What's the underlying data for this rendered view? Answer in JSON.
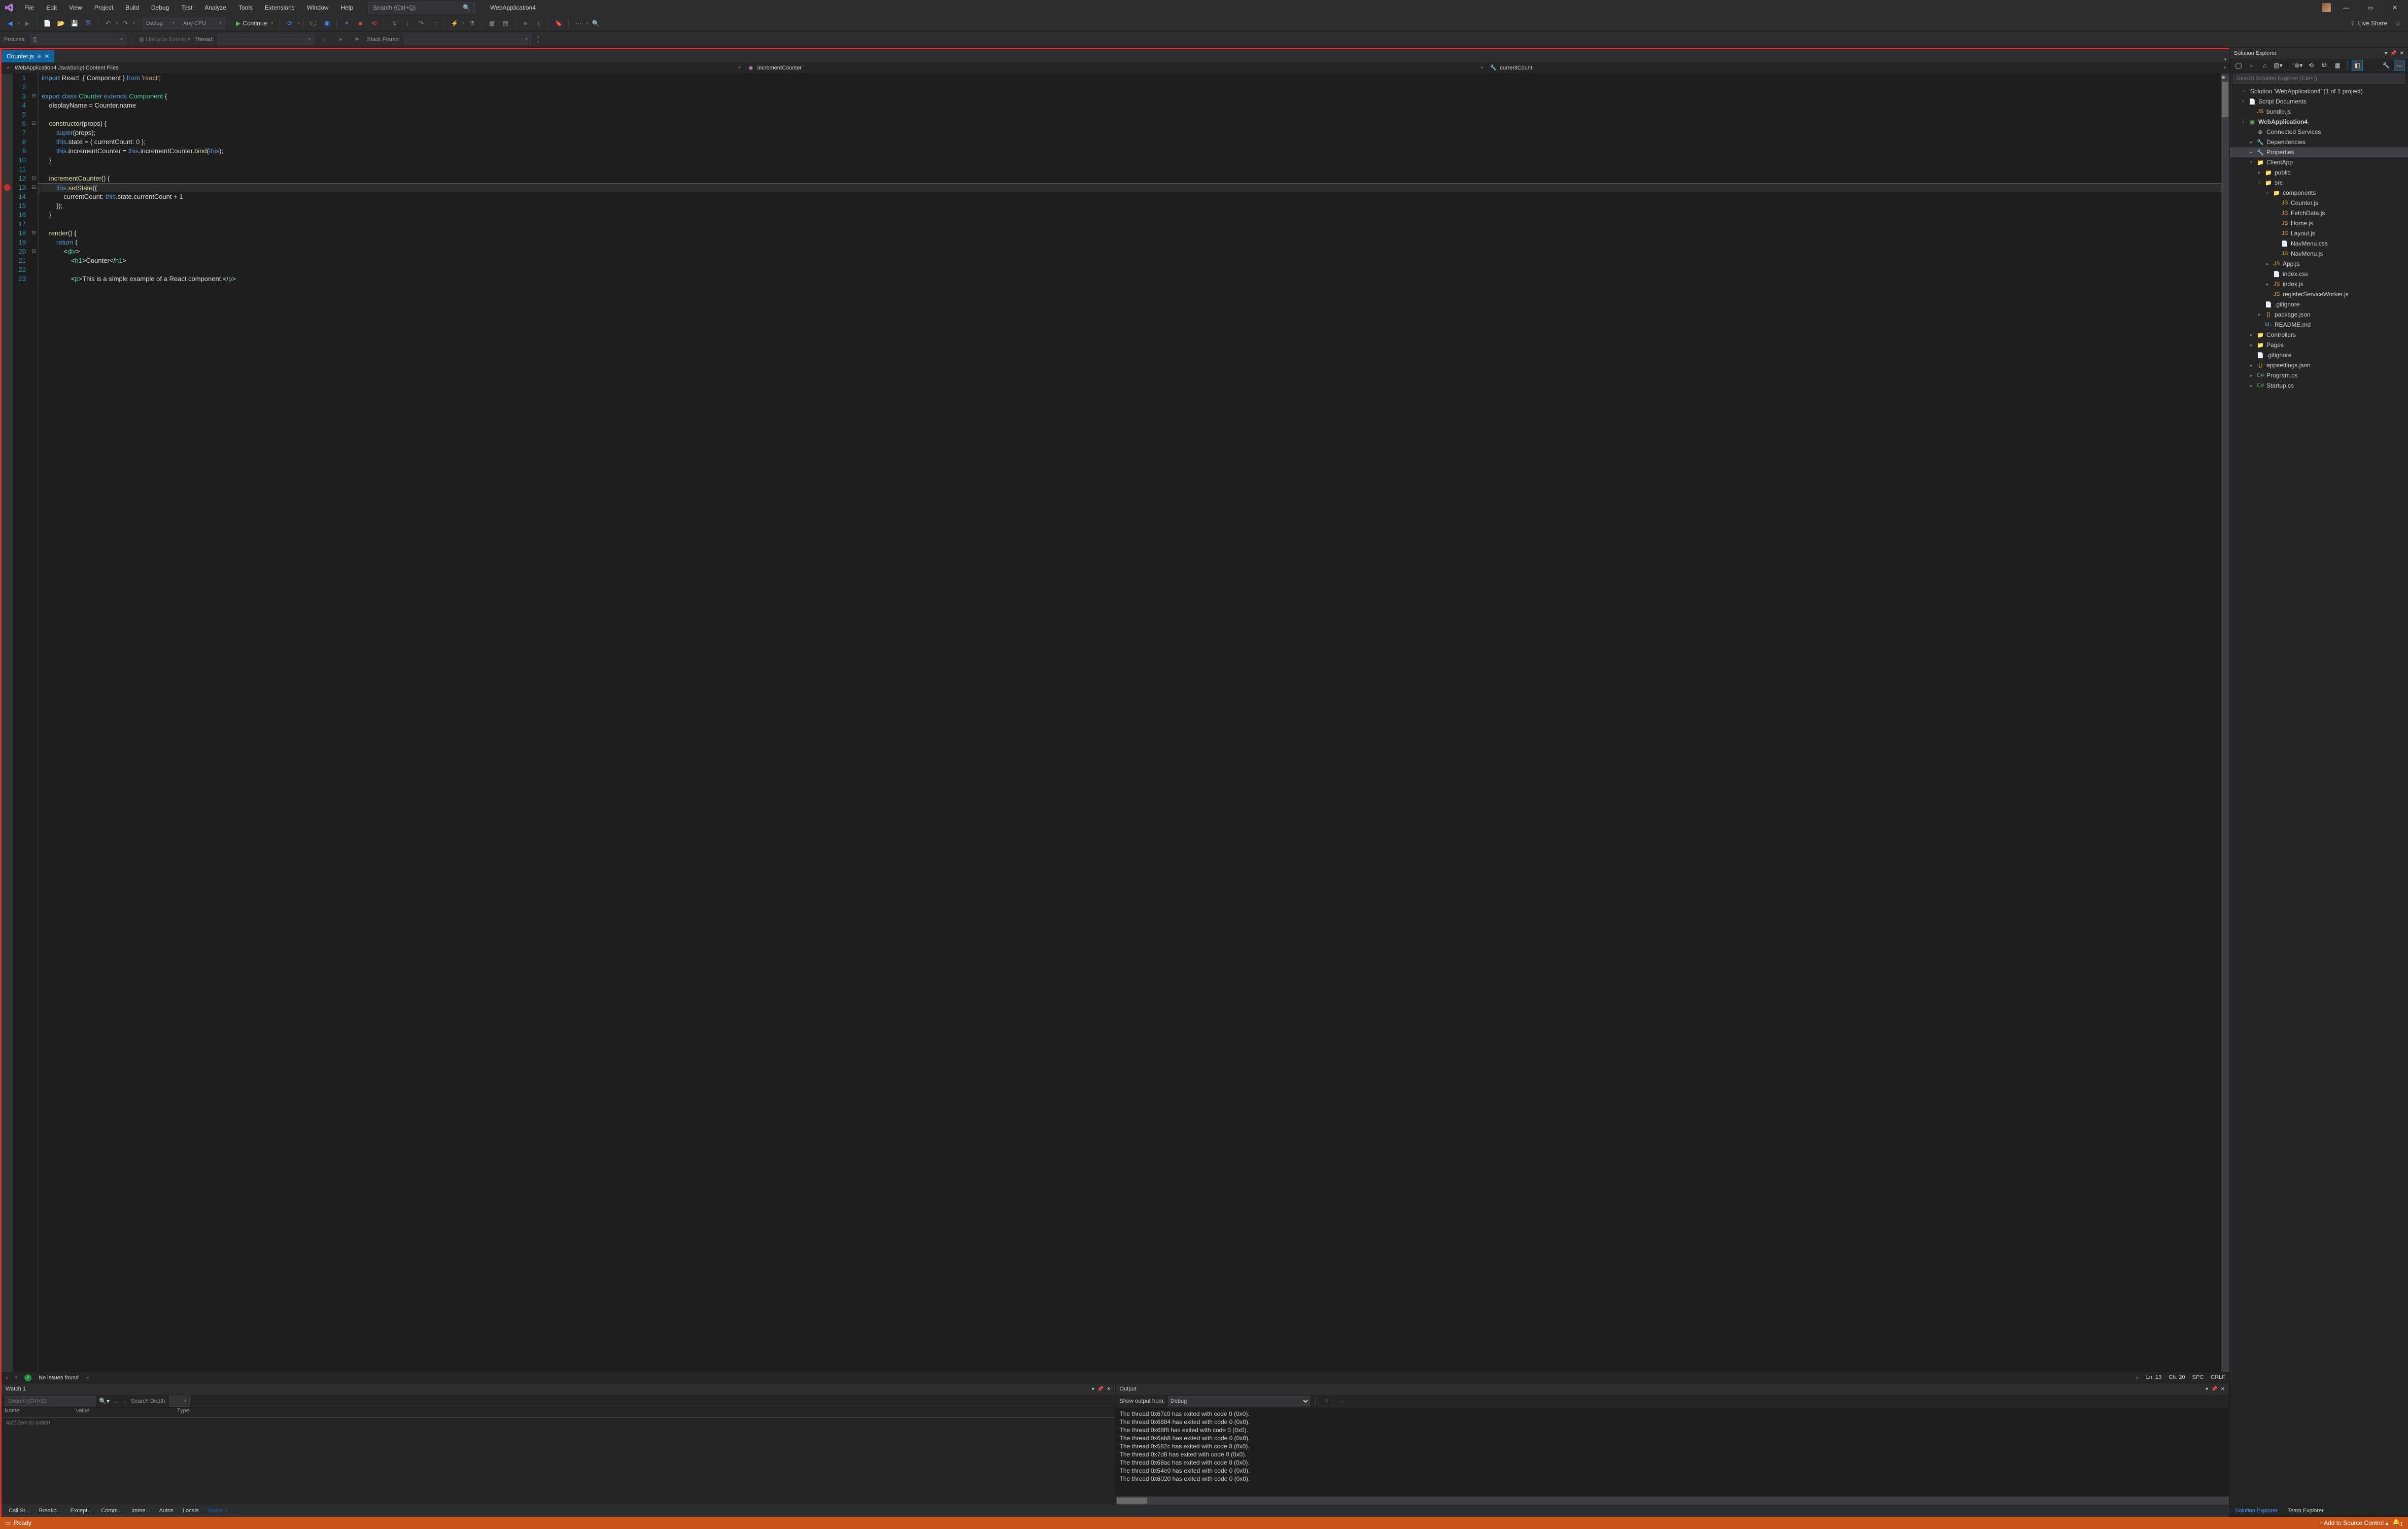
{
  "title": "WebApplication4",
  "searchPlaceholder": "Search (Ctrl+Q)",
  "menu": [
    "File",
    "Edit",
    "View",
    "Project",
    "Build",
    "Debug",
    "Test",
    "Analyze",
    "Tools",
    "Extensions",
    "Window",
    "Help"
  ],
  "toolbar": {
    "config": "Debug",
    "platform": "Any CPU",
    "continue": "Continue",
    "liveshare": "Live Share",
    "process": "Process:",
    "processVal": "[]",
    "lifecycle": "Lifecycle Events",
    "thread": "Thread:",
    "stackframe": "Stack Frame:"
  },
  "tab": {
    "name": "Counter.js"
  },
  "navbar": {
    "scope": "WebApplication4 JavaScript Content Files",
    "member": "incrementCounter",
    "detail": "currentCount"
  },
  "code": {
    "lines": [
      {
        "n": 1,
        "f": "",
        "h": "<span class='k-blue'>import</span> React, { Component } <span class='k-blue'>from</span> <span class='k-str'>'react'</span>;",
        "ind": 1
      },
      {
        "n": 2,
        "f": "",
        "h": "",
        "ind": 1
      },
      {
        "n": 3,
        "f": "⊟",
        "h": "<span class='k-blue'>export</span> <span class='k-blue'>class</span> <span class='k-type'>Counter</span> <span class='k-blue'>extends</span> <span class='k-type'>Component</span> {",
        "ind": 0
      },
      {
        "n": 4,
        "f": "",
        "h": "    displayName = Counter.name",
        "ind": 1
      },
      {
        "n": 5,
        "f": "",
        "h": "",
        "ind": 1
      },
      {
        "n": 6,
        "f": "⊟",
        "h": "    <span class='k-func'>constructor</span>(props) {",
        "ind": 1
      },
      {
        "n": 7,
        "f": "",
        "h": "        <span class='k-blue'>super</span>(props);",
        "ind": 1
      },
      {
        "n": 8,
        "f": "",
        "h": "        <span class='k-blue'>this</span>.state = { currentCount: <span class='k-num'>0</span> };",
        "ind": 1
      },
      {
        "n": 9,
        "f": "",
        "h": "        <span class='k-blue'>this</span>.incrementCounter = <span class='k-blue'>this</span>.incrementCounter.<span class='k-func'>bind</span>(<span class='k-blue'>this</span>);",
        "ind": 1
      },
      {
        "n": 10,
        "f": "",
        "h": "    }",
        "ind": 1
      },
      {
        "n": 11,
        "f": "",
        "h": "",
        "ind": 1
      },
      {
        "n": 12,
        "f": "⊟",
        "h": "    <span class='k-func'>incrementCounter</span>() {",
        "ind": 1
      },
      {
        "n": 13,
        "f": "⊟",
        "h": "        <span class='k-blue'>this</span>.<span class='k-func'>setState</span>({",
        "ind": 1,
        "bp": true,
        "cur": true
      },
      {
        "n": 14,
        "f": "",
        "h": "            currentCount: <span class='k-blue'>this</span>.state.currentCount + <span class='k-num'>1</span>",
        "ind": 1
      },
      {
        "n": 15,
        "f": "",
        "h": "        });",
        "ind": 1
      },
      {
        "n": 16,
        "f": "",
        "h": "    }",
        "ind": 1
      },
      {
        "n": 17,
        "f": "",
        "h": "",
        "ind": 1
      },
      {
        "n": 18,
        "f": "⊟",
        "h": "    <span class='k-func'>render</span>() {",
        "ind": 1
      },
      {
        "n": 19,
        "f": "",
        "h": "        <span class='k-blue'>return</span> (",
        "ind": 1
      },
      {
        "n": 20,
        "f": "⊟",
        "h": "            &lt;<span class='k-type'>div</span>&gt;",
        "ind": 1
      },
      {
        "n": 21,
        "f": "",
        "h": "                &lt;<span class='k-type'>h1</span>&gt;Counter&lt;/<span class='k-type'>h1</span>&gt;",
        "ind": 1
      },
      {
        "n": 22,
        "f": "",
        "h": "",
        "ind": 1
      },
      {
        "n": 23,
        "f": "",
        "h": "                &lt;<span class='k-type'>p</span>&gt;This is a simple example of a React component.&lt;/<span class='k-type'>p</span>&gt;",
        "ind": 1
      }
    ],
    "status": {
      "issues": "No issues found",
      "ln": "Ln: 13",
      "ch": "Ch: 20",
      "spc": "SPC",
      "crlf": "CRLF"
    }
  },
  "watch": {
    "title": "Watch 1",
    "searchPh": "Search (Ctrl+E)",
    "depth": "Search Depth:",
    "cols": [
      "Name",
      "Value",
      "Type"
    ],
    "placeholder": "Add item to watch"
  },
  "output": {
    "title": "Output",
    "fromLbl": "Show output from:",
    "from": "Debug",
    "lines": [
      "The thread 0x67c0 has exited with code 0 (0x0).",
      "The thread 0x6884 has exited with code 0 (0x0).",
      "The thread 0x68f8 has exited with code 0 (0x0).",
      "The thread 0x6ab8 has exited with code 0 (0x0).",
      "The thread 0x582c has exited with code 0 (0x0).",
      "The thread 0x7d8 has exited with code 0 (0x0).",
      "The thread 0x68ac has exited with code 0 (0x0).",
      "The thread 0x54e0 has exited with code 0 (0x0).",
      "The thread 0x6020 has exited with code 0 (0x0)."
    ]
  },
  "bottomTabs": [
    "Call St...",
    "Breakp...",
    "Except...",
    "Comm...",
    "Imme...",
    "Autos",
    "Locals",
    "Watch 1"
  ],
  "se": {
    "title": "Solution Explorer",
    "searchPh": "Search Solution Explorer (Ctrl+;)",
    "solution": "Solution 'WebApplication4' (1 of 1 project)",
    "tabs": [
      "Solution Explorer",
      "Team Explorer"
    ]
  },
  "tree": [
    {
      "d": 0,
      "e": "",
      "i": "i-sln",
      "t": "Solution 'WebApplication4' (1 of 1 project)"
    },
    {
      "d": 1,
      "e": "▿",
      "i": "i-scr",
      "t": "Script Documents"
    },
    {
      "d": 2,
      "e": "",
      "i": "i-js",
      "t": "bundle.js"
    },
    {
      "d": 1,
      "e": "▿",
      "i": "i-proj",
      "t": "WebApplication4",
      "b": true
    },
    {
      "d": 2,
      "e": "",
      "i": "i-conn",
      "t": "Connected Services"
    },
    {
      "d": 2,
      "e": "▸",
      "i": "i-wr",
      "t": "Dependencies"
    },
    {
      "d": 2,
      "e": "▸",
      "i": "i-wr",
      "t": "Properties",
      "sel": true
    },
    {
      "d": 2,
      "e": "▿",
      "i": "i-fold",
      "t": "ClientApp"
    },
    {
      "d": 3,
      "e": "▸",
      "i": "i-fold",
      "t": "public"
    },
    {
      "d": 3,
      "e": "▿",
      "i": "i-fold",
      "t": "src"
    },
    {
      "d": 4,
      "e": "▿",
      "i": "i-fold",
      "t": "components"
    },
    {
      "d": 5,
      "e": "",
      "i": "i-js",
      "t": "Counter.js"
    },
    {
      "d": 5,
      "e": "",
      "i": "i-js",
      "t": "FetchData.js"
    },
    {
      "d": 5,
      "e": "",
      "i": "i-js",
      "t": "Home.js"
    },
    {
      "d": 5,
      "e": "",
      "i": "i-js",
      "t": "Layout.js"
    },
    {
      "d": 5,
      "e": "",
      "i": "i-css",
      "t": "NavMenu.css"
    },
    {
      "d": 5,
      "e": "",
      "i": "i-js",
      "t": "NavMenu.js"
    },
    {
      "d": 4,
      "e": "▸",
      "i": "i-js",
      "t": "App.js"
    },
    {
      "d": 4,
      "e": "",
      "i": "i-css",
      "t": "index.css"
    },
    {
      "d": 4,
      "e": "▸",
      "i": "i-js",
      "t": "index.js"
    },
    {
      "d": 4,
      "e": "",
      "i": "i-js",
      "t": "registerServiceWorker.js"
    },
    {
      "d": 3,
      "e": "",
      "i": "i-scr",
      "t": ".gitignore"
    },
    {
      "d": 3,
      "e": "▸",
      "i": "i-json",
      "t": "package.json"
    },
    {
      "d": 3,
      "e": "",
      "i": "i-md",
      "t": "README.md"
    },
    {
      "d": 2,
      "e": "▸",
      "i": "i-fold",
      "t": "Controllers"
    },
    {
      "d": 2,
      "e": "▸",
      "i": "i-fold",
      "t": "Pages"
    },
    {
      "d": 2,
      "e": "",
      "i": "i-scr",
      "t": ".gitignore"
    },
    {
      "d": 2,
      "e": "▸",
      "i": "i-json",
      "t": "appsettings.json"
    },
    {
      "d": 2,
      "e": "▸",
      "i": "i-cs",
      "t": "Program.cs"
    },
    {
      "d": 2,
      "e": "▸",
      "i": "i-cs",
      "t": "Startup.cs"
    }
  ],
  "status": {
    "ready": "Ready",
    "src": "Add to Source Control"
  }
}
